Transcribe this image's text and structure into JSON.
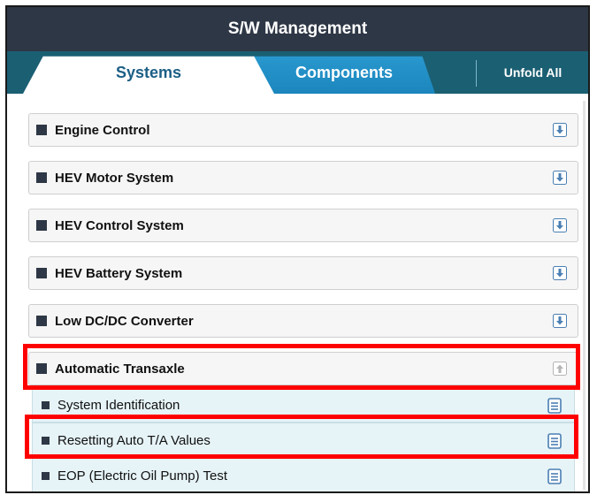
{
  "window": {
    "title": "S/W Management"
  },
  "tabs": [
    {
      "label": "Systems",
      "active": true
    },
    {
      "label": "Components",
      "active": false
    }
  ],
  "toolbar": {
    "unfold_label": "Unfold All"
  },
  "systems": [
    {
      "label": "Engine Control",
      "icon": "download-icon"
    },
    {
      "label": "HEV Motor System",
      "icon": "download-icon"
    },
    {
      "label": "HEV Control System",
      "icon": "download-icon"
    },
    {
      "label": "HEV Battery System",
      "icon": "download-icon"
    },
    {
      "label": "Low DC/DC Converter",
      "icon": "download-icon"
    },
    {
      "label": "Automatic Transaxle",
      "icon": "upload-icon",
      "expanded": true,
      "highlighted": true
    }
  ],
  "sub_items": [
    {
      "label": "System Identification",
      "icon": "document-icon"
    },
    {
      "label": "Resetting Auto T/A Values",
      "icon": "document-icon",
      "highlighted": true
    },
    {
      "label": "EOP (Electric Oil Pump) Test",
      "icon": "document-icon"
    }
  ],
  "colors": {
    "title_bar": "#2e3745",
    "tab_bar": "#1b5f73",
    "active_tab_text": "#1c5f86",
    "inactive_tab": "#1b86bd",
    "sub_item_bg": "#e6f3f7",
    "icon_blue": "#4a7fb3",
    "highlight": "#ff0000"
  }
}
